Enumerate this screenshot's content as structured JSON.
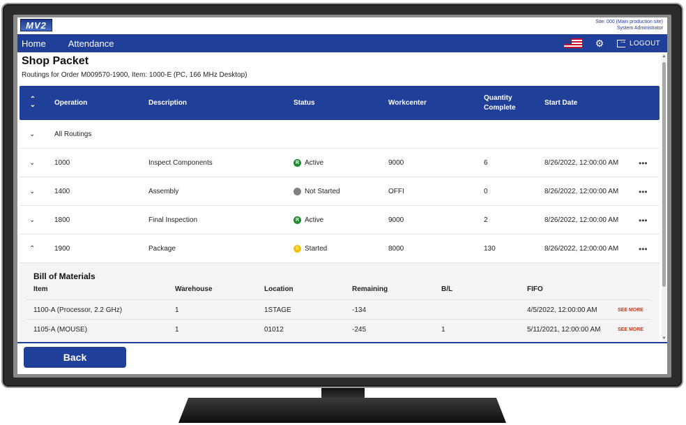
{
  "header": {
    "logo_text": "MV2",
    "site": "Site: 000 (Main production site)",
    "user": "System Administrator"
  },
  "nav": {
    "home": "Home",
    "attendance": "Attendance",
    "logout": "LOGOUT",
    "flag_icon": "us-flag-icon",
    "settings_icon": "gear-icon"
  },
  "page": {
    "title": "Shop Packet",
    "subtitle": "Routings for Order M009570-1900, Item: 1000-E (PC, 166 MHz Desktop)"
  },
  "table": {
    "headers": {
      "operation": "Operation",
      "description": "Description",
      "status": "Status",
      "workcenter": "Workcenter",
      "quantity_complete": "Quantity Complete",
      "start_date": "Start Date"
    },
    "all_routings": "All Routings",
    "rows": [
      {
        "operation": "1000",
        "description": "Inspect Components",
        "status": "Active",
        "status_badge": "R",
        "status_color": "#1e8a2e",
        "workcenter": "9000",
        "quantity": "6",
        "start_date": "8/26/2022, 12:00:00 AM",
        "expanded": false
      },
      {
        "operation": "1400",
        "description": "Assembly",
        "status": "Not Started",
        "status_badge": "",
        "status_color": "#808080",
        "workcenter": "OFFI",
        "quantity": "0",
        "start_date": "8/26/2022, 12:00:00 AM",
        "expanded": false
      },
      {
        "operation": "1800",
        "description": "Final Inspection",
        "status": "Active",
        "status_badge": "R",
        "status_color": "#1e8a2e",
        "workcenter": "9000",
        "quantity": "2",
        "start_date": "8/26/2022, 12:00:00 AM",
        "expanded": false
      },
      {
        "operation": "1900",
        "description": "Package",
        "status": "Started",
        "status_badge": "II",
        "status_color": "#f2c21b",
        "workcenter": "8000",
        "quantity": "130",
        "start_date": "8/26/2022, 12:00:00 AM",
        "expanded": true
      }
    ]
  },
  "bom": {
    "title": "Bill of Materials",
    "headers": {
      "item": "Item",
      "warehouse": "Warehouse",
      "location": "Location",
      "remaining": "Remaining",
      "bl": "B/L",
      "fifo": "FIFO"
    },
    "see_more": "SEE MORE",
    "rows": [
      {
        "item": "1100-A (Processor, 2.2 GHz)",
        "warehouse": "1",
        "location": "1STAGE",
        "remaining": "-134",
        "bl": "",
        "fifo": "4/5/2022, 12:00:00 AM"
      },
      {
        "item": "1105-A (MOUSE)",
        "warehouse": "1",
        "location": "01012",
        "remaining": "-245",
        "bl": "1",
        "fifo": "5/11/2021, 12:00:00 AM"
      }
    ]
  },
  "footer": {
    "back": "Back"
  }
}
